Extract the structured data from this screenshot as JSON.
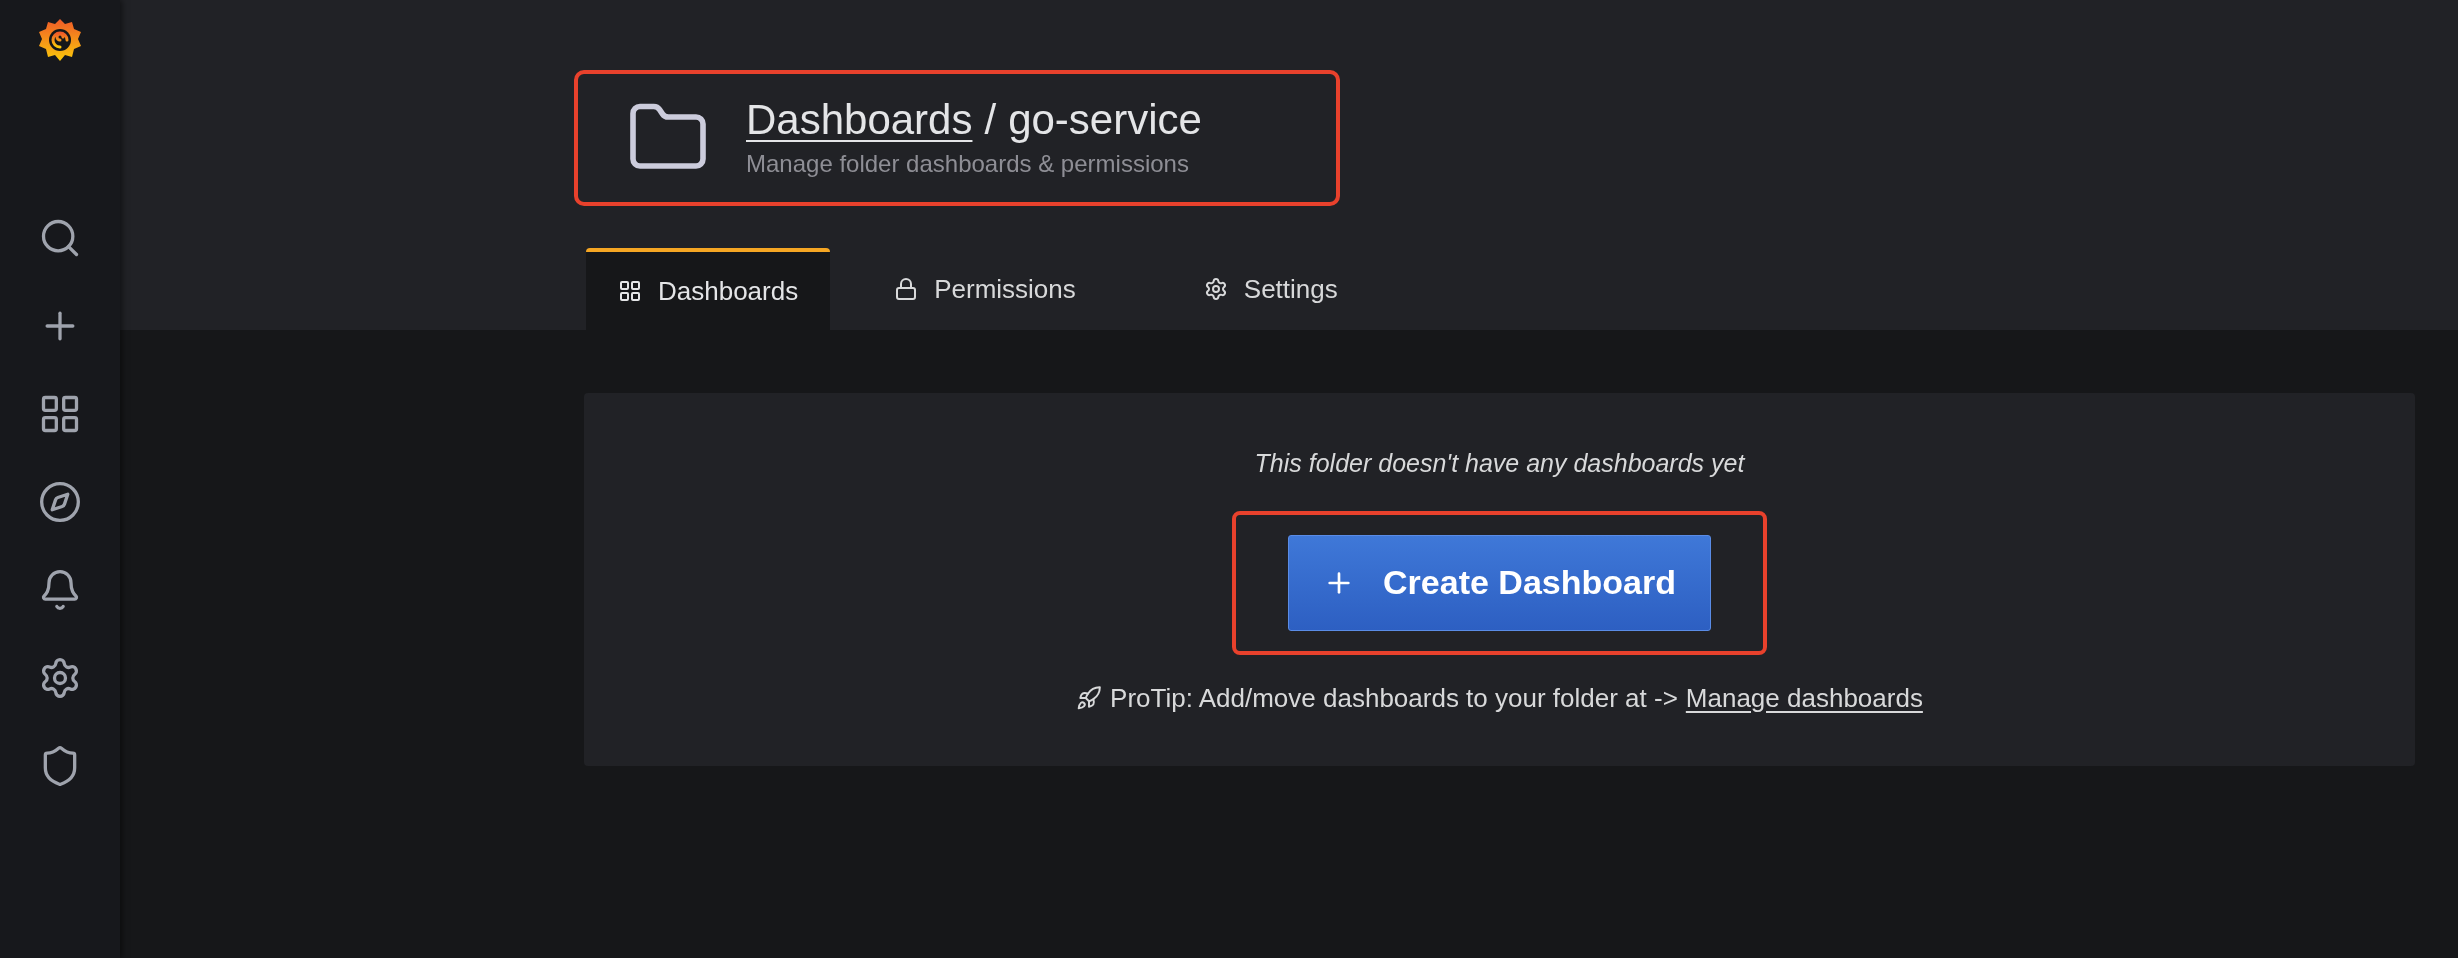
{
  "header": {
    "breadcrumb_link": "Dashboards",
    "separator": "/",
    "title": "go-service",
    "subtitle": "Manage folder dashboards & permissions"
  },
  "tabs": [
    {
      "label": "Dashboards",
      "kind": "dashboards",
      "selected": true
    },
    {
      "label": "Permissions",
      "kind": "permissions",
      "selected": false
    },
    {
      "label": "Settings",
      "kind": "settings",
      "selected": false
    }
  ],
  "empty_state": {
    "message": "This folder doesn't have any dashboards yet",
    "button_label": "Create Dashboard",
    "protip_text": "ProTip: Add/move dashboards to your folder at ->",
    "protip_link": "Manage dashboards"
  }
}
